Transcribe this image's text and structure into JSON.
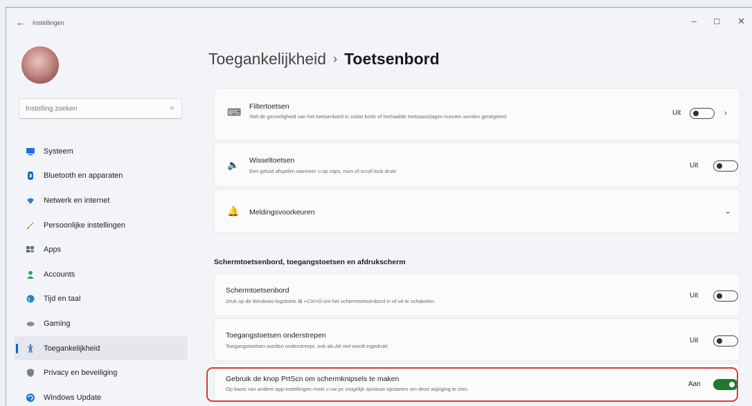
{
  "window": {
    "title": "Instellingen",
    "back": "←",
    "minimize": "–",
    "maximize": "☐",
    "close": "✕"
  },
  "sidebar": {
    "search": {
      "placeholder": "Instelling zoeken",
      "icon": "search-icon"
    },
    "items": [
      {
        "label": "Systeem",
        "icon": "monitor-icon",
        "color": "#1a73d9"
      },
      {
        "label": "Bluetooth en apparaten",
        "icon": "bluetooth-icon",
        "color": "#0a66d0"
      },
      {
        "label": "Netwerk en internet",
        "icon": "wifi-icon",
        "color": "#2a7de0"
      },
      {
        "label": "Persoonlijke instellingen",
        "icon": "brush-icon",
        "color": "#e0913a"
      },
      {
        "label": "Apps",
        "icon": "apps-icon",
        "color": "#5a6a80"
      },
      {
        "label": "Accounts",
        "icon": "person-icon",
        "color": "#2aa05a"
      },
      {
        "label": "Tijd en taal",
        "icon": "globe-icon",
        "color": "#1e88c8"
      },
      {
        "label": "Gaming",
        "icon": "controller-icon",
        "color": "#8a8a8a"
      },
      {
        "label": "Toegankelijkheid",
        "icon": "accessibility-icon",
        "color": "#1b6fcf",
        "active": true
      },
      {
        "label": "Privacy en beveiliging",
        "icon": "shield-icon",
        "color": "#7a8090"
      },
      {
        "label": "Windows Update",
        "icon": "update-icon",
        "color": "#1a73d9"
      }
    ]
  },
  "main": {
    "breadcrumb": {
      "parent": "Toegankelijkheid",
      "separator": "›",
      "current": "Toetsenbord"
    },
    "cards": [
      {
        "title": "Filtertoetsen",
        "description": "Stel de gevoeligheid van het toetsenbord in zodat korte of herhaalde toetsaanslagen kunnen worden genegeerd.",
        "icon": "keyboard-filter-icon",
        "state": "Uit",
        "on": false,
        "chevron": "›"
      },
      {
        "title": "Wisseltoetsen",
        "description": "Een geluid afspelen wanneer u op caps, num of scroll lock drukt",
        "icon": "speaker-icon",
        "state": "Uit",
        "on": false
      },
      {
        "title": "Meldingsvoorkeuren",
        "icon": "bell-icon",
        "chevron": "⌄"
      }
    ],
    "section_title": "Schermtoetsenbord, toegangstoetsen en afdrukscherm",
    "section_cards": [
      {
        "title": "Schermtoetsenbord",
        "description": "Druk op de Windows-logotoets ⊞ +Ctrl+O om het schermtoetsenbord in of uit te schakelen.",
        "state": "Uit",
        "on": false
      },
      {
        "title": "Toegangstoetsen onderstrepen",
        "description": "Toegangstoetsen worden onderstreept, ook als Alt niet wordt ingedrukt",
        "state": "Uit",
        "on": false
      },
      {
        "title": "Gebruik de knop PrtScn om schermknipsels te maken",
        "description": "Op basis van andere app-instellingen moet u uw pc mogelijk opnieuw opstarten om deze wijziging te zien.",
        "state": "Aan",
        "on": true,
        "highlight_color": "#d23a3a"
      }
    ]
  }
}
